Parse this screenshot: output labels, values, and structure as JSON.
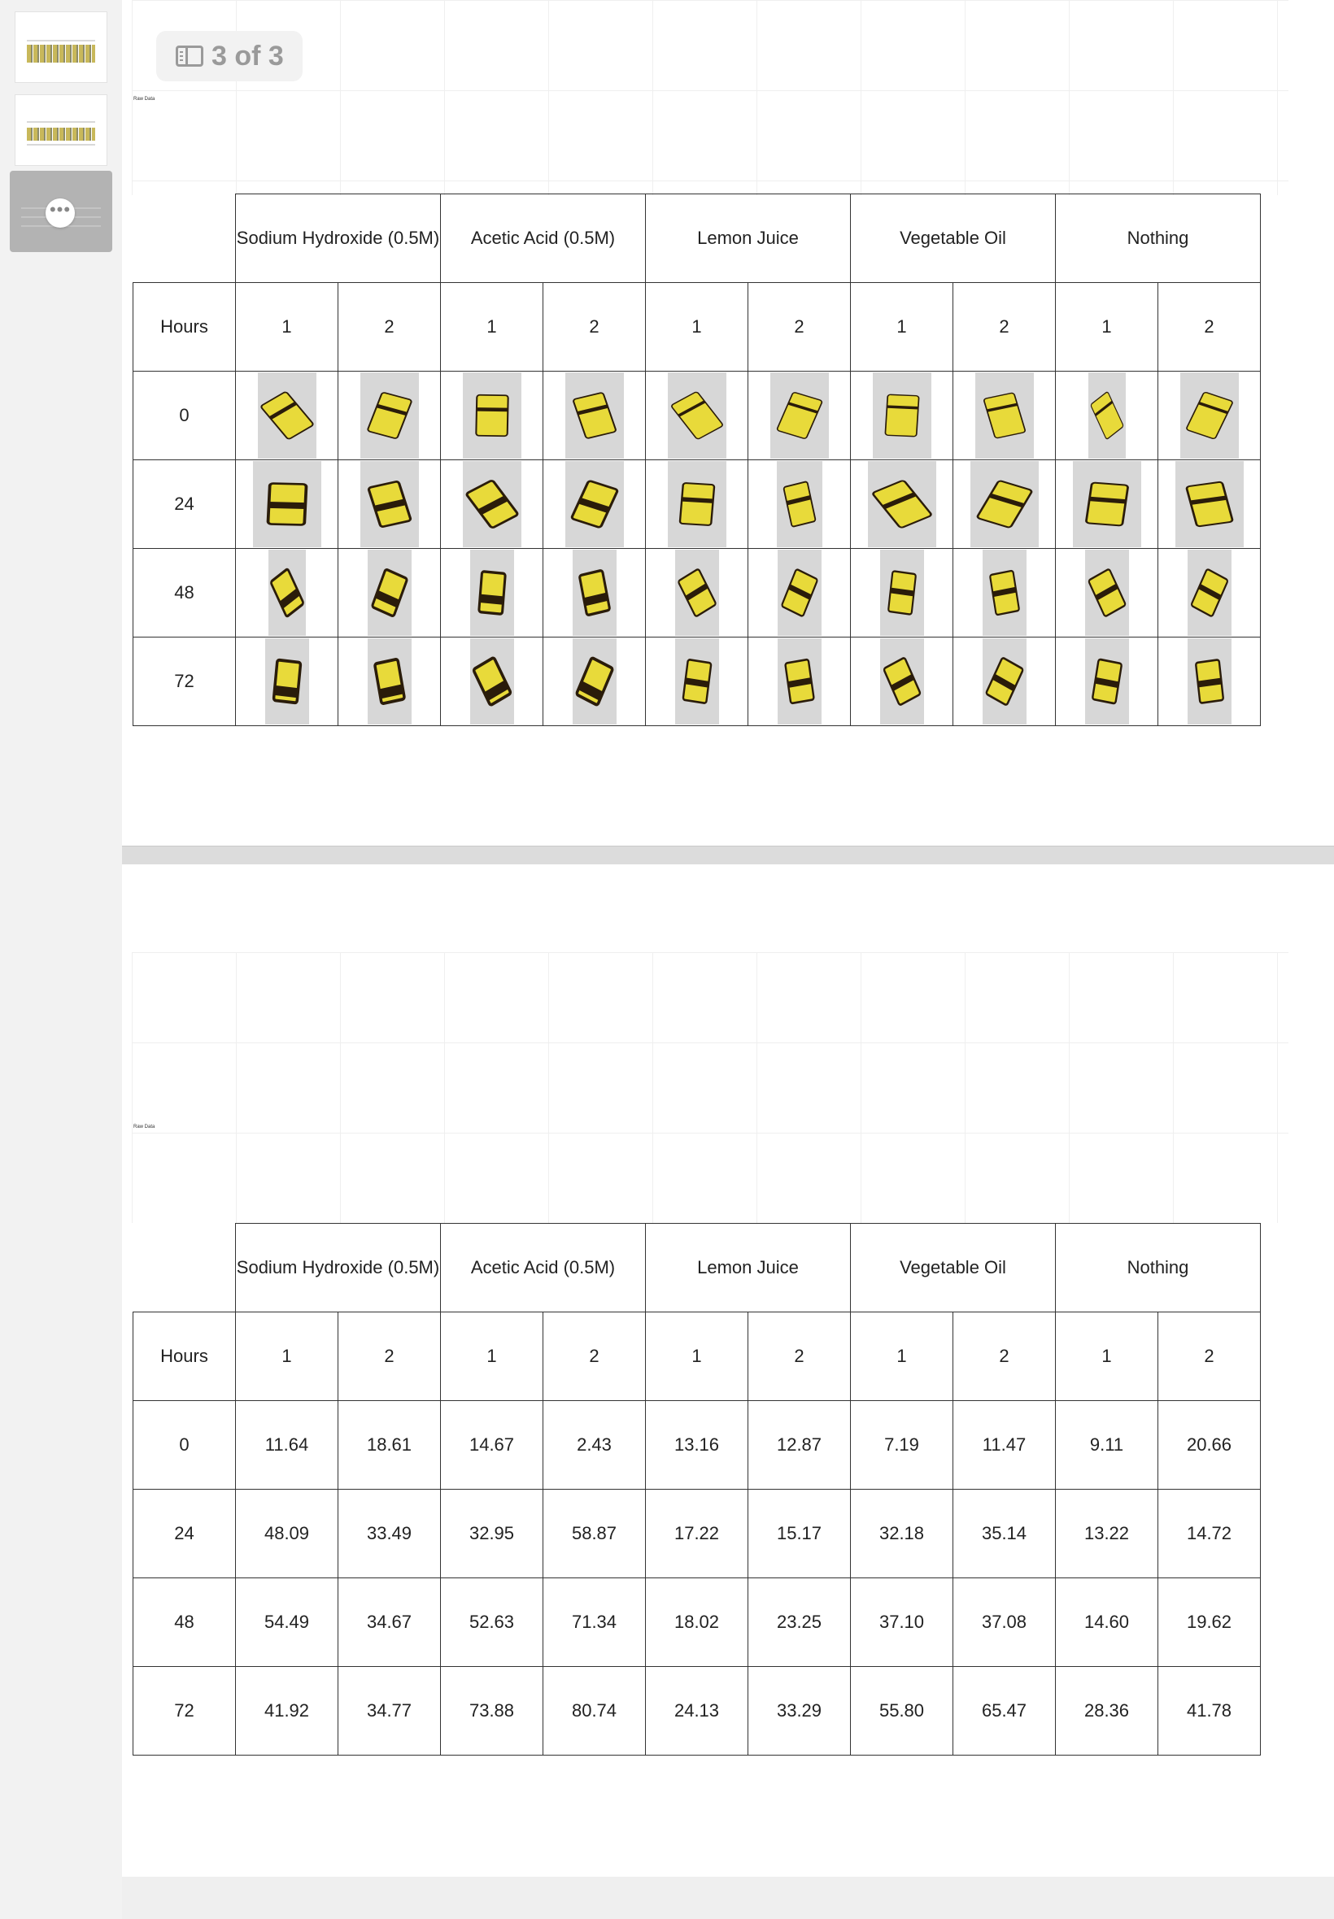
{
  "pager": {
    "label": "3 of 3"
  },
  "slides": {
    "label": "Raw Data"
  },
  "table": {
    "group_headers": [
      "Sodium Hydroxide (0.5M)",
      "Acetic Acid (0.5M)",
      "Lemon Juice",
      "Vegetable Oil",
      "Nothing"
    ],
    "row_header": "Hours",
    "trials": [
      "1",
      "2",
      "1",
      "2",
      "1",
      "2",
      "1",
      "2",
      "1",
      "2"
    ],
    "hours": [
      "0",
      "24",
      "48",
      "72"
    ]
  },
  "values": [
    [
      "11.64",
      "18.61",
      "14.67",
      "2.43",
      "13.16",
      "12.87",
      "7.19",
      "11.47",
      "9.11",
      "20.66"
    ],
    [
      "48.09",
      "33.49",
      "32.95",
      "58.87",
      "17.22",
      "15.17",
      "32.18",
      "35.14",
      "13.22",
      "14.72"
    ],
    [
      "54.49",
      "34.67",
      "52.63",
      "71.34",
      "18.02",
      "23.25",
      "37.10",
      "37.08",
      "14.60",
      "19.62"
    ],
    [
      "41.92",
      "34.77",
      "73.88",
      "80.74",
      "24.13",
      "33.29",
      "55.80",
      "65.47",
      "28.36",
      "41.78"
    ]
  ],
  "colors": {
    "sample_yellow": "#e8da3a",
    "browning": "#2a1c0a",
    "photo_bg": "#d7d7d7"
  }
}
